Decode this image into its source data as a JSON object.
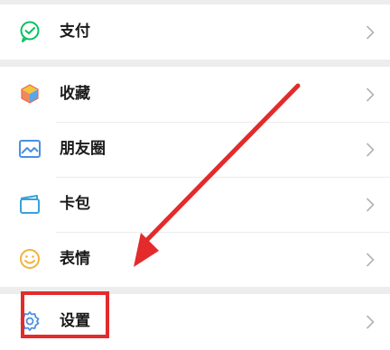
{
  "menu": {
    "pay": {
      "label": "支付",
      "icon": "wechat-pay-icon"
    },
    "favorites": {
      "label": "收藏",
      "icon": "favorites-cube-icon"
    },
    "moments": {
      "label": "朋友圈",
      "icon": "moments-picture-icon"
    },
    "cards": {
      "label": "卡包",
      "icon": "card-wallet-icon"
    },
    "stickers": {
      "label": "表情",
      "icon": "smiley-face-icon"
    },
    "settings": {
      "label": "设置",
      "icon": "gear-icon"
    }
  },
  "colors": {
    "background": "#ededed",
    "row": "#ffffff",
    "annotation_red": "#e32b2b",
    "pay_green": "#07c160",
    "chevron": "#b2b2b2"
  }
}
